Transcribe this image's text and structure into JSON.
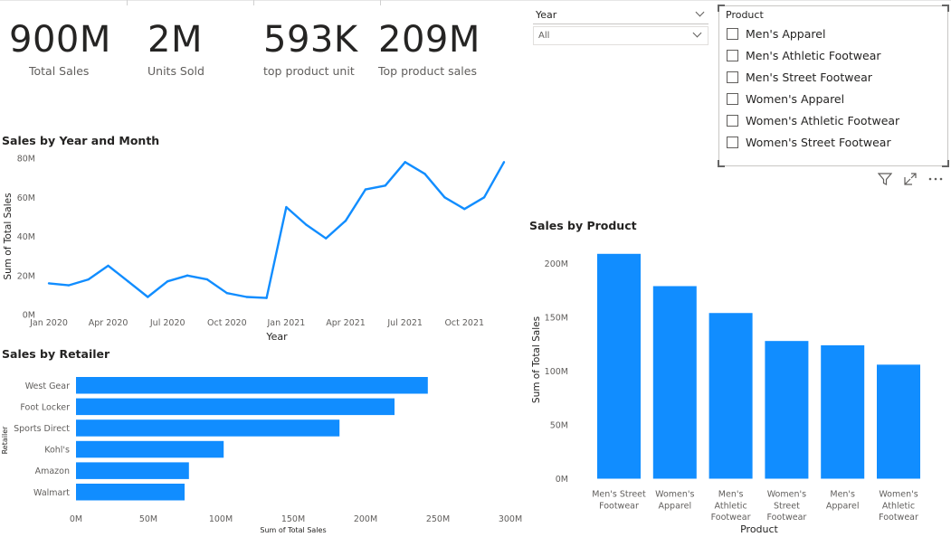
{
  "kpis": [
    {
      "value": "900M",
      "label": "Total Sales"
    },
    {
      "value": "2M",
      "label": "Units Sold"
    },
    {
      "value": "593K",
      "label": "top product unit"
    },
    {
      "value": "209M",
      "label": "Top product sales"
    }
  ],
  "year_slicer": {
    "title": "Year",
    "selected": "All"
  },
  "product_slicer": {
    "title": "Product",
    "items": [
      "Men's Apparel",
      "Men's Athletic Footwear",
      "Men's Street Footwear",
      "Women's Apparel",
      "Women's Athletic Footwear",
      "Women's Street Footwear"
    ]
  },
  "colors": {
    "accent": "#118dff",
    "text": "#252423",
    "muted": "#605e5c",
    "tick": "#605e5c"
  },
  "icons": [
    "filter-icon",
    "focus-mode-icon",
    "more-options-icon"
  ],
  "chart_data": [
    {
      "type": "line",
      "title": "Sales by Year and Month",
      "xlabel": "Year",
      "ylabel": "Sum of Total Sales",
      "x": [
        "Jan 2020",
        "Feb 2020",
        "Mar 2020",
        "Apr 2020",
        "May 2020",
        "Jun 2020",
        "Jul 2020",
        "Aug 2020",
        "Sep 2020",
        "Oct 2020",
        "Nov 2020",
        "Dec 2020",
        "Jan 2021",
        "Feb 2021",
        "Mar 2021",
        "Apr 2021",
        "May 2021",
        "Jun 2021",
        "Jul 2021",
        "Aug 2021",
        "Sep 2021",
        "Oct 2021",
        "Nov 2021",
        "Dec 2021"
      ],
      "x_ticks": [
        "Jan 2020",
        "Apr 2020",
        "Jul 2020",
        "Oct 2020",
        "Jan 2021",
        "Apr 2021",
        "Jul 2021",
        "Oct 2021"
      ],
      "values": [
        16,
        15,
        18,
        25,
        17,
        9,
        17,
        20,
        18,
        11,
        9,
        8.5,
        55,
        46,
        39,
        48,
        64,
        66,
        78,
        72,
        60,
        54,
        60,
        78
      ],
      "unit": "M",
      "ylim": [
        0,
        80
      ],
      "y_ticks": [
        "0M",
        "20M",
        "40M",
        "60M",
        "80M"
      ],
      "grid": false
    },
    {
      "type": "bar",
      "orientation": "horizontal",
      "title": "Sales by Retailer",
      "xlabel": "Sum of Total Sales",
      "ylabel": "Retailer",
      "categories": [
        "West Gear",
        "Foot Locker",
        "Sports Direct",
        "Kohl's",
        "Amazon",
        "Walmart"
      ],
      "values": [
        243,
        220,
        182,
        102,
        78,
        75
      ],
      "unit": "M",
      "xlim": [
        0,
        300
      ],
      "x_ticks": [
        "0M",
        "50M",
        "100M",
        "150M",
        "200M",
        "250M",
        "300M"
      ],
      "grid": false
    },
    {
      "type": "bar",
      "title": "Sales by Product",
      "xlabel": "Product",
      "ylabel": "Sum of Total Sales",
      "categories": [
        [
          "Men's Street",
          "Footwear"
        ],
        [
          "Women's",
          "Apparel"
        ],
        [
          "Men's",
          "Athletic",
          "Footwear"
        ],
        [
          "Women's",
          "Street",
          "Footwear"
        ],
        [
          "Men's",
          "Apparel"
        ],
        [
          "Women's",
          "Athletic",
          "Footwear"
        ]
      ],
      "values": [
        209,
        179,
        154,
        128,
        124,
        106
      ],
      "unit": "M",
      "ylim": [
        0,
        200
      ],
      "y_ticks": [
        "0M",
        "50M",
        "100M",
        "150M",
        "200M"
      ],
      "grid": false
    }
  ]
}
